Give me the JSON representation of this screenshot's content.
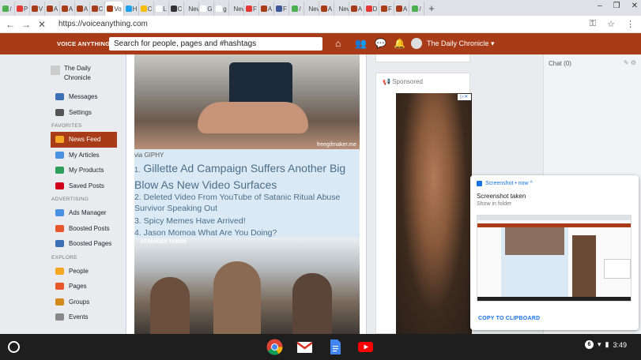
{
  "browser": {
    "tabs": [
      {
        "label": "/",
        "color": "#4caf50"
      },
      {
        "label": "P",
        "color": "#e53935"
      },
      {
        "label": "V",
        "color": "#a93c18"
      },
      {
        "label": "A",
        "color": "#a93c18"
      },
      {
        "label": "A",
        "color": "#a93c18"
      },
      {
        "label": "A",
        "color": "#a93c18"
      },
      {
        "label": "C",
        "color": "#a93c18"
      },
      {
        "label": "Vo",
        "color": "#a93c18",
        "active": true
      },
      {
        "label": "H",
        "color": "#1da1f2"
      },
      {
        "label": "C",
        "color": "#fbbc04"
      },
      {
        "label": "L",
        "color": "#fff"
      },
      {
        "label": "C",
        "color": "#333"
      },
      {
        "label": "New",
        "color": "#dee1e6"
      },
      {
        "label": "G",
        "color": "#fff"
      },
      {
        "label": "g",
        "color": "#fff"
      },
      {
        "label": "New",
        "color": "#dee1e6"
      },
      {
        "label": "F",
        "color": "#e53935"
      },
      {
        "label": "A",
        "color": "#a93c18"
      },
      {
        "label": "F",
        "color": "#3b5998"
      },
      {
        "label": "/",
        "color": "#4caf50"
      },
      {
        "label": "New",
        "color": "#dee1e6"
      },
      {
        "label": "A",
        "color": "#a93c18"
      },
      {
        "label": "New",
        "color": "#dee1e6"
      },
      {
        "label": "A",
        "color": "#a93c18"
      },
      {
        "label": "D",
        "color": "#e53935"
      },
      {
        "label": "F",
        "color": "#a93c18"
      },
      {
        "label": "A",
        "color": "#a93c18"
      },
      {
        "label": "/",
        "color": "#4caf50"
      }
    ],
    "new_tab": "+",
    "url": "https://voiceanything.com"
  },
  "header": {
    "brand": "VOICE ANYTHING",
    "search_placeholder": "Search for people, pages and #hashtags",
    "user_name": "The Daily Chronicle ▾"
  },
  "sidebar": {
    "profile_name": "The Daily Chronicle",
    "top_items": [
      {
        "label": "Messages",
        "color": "#3b6fb6"
      },
      {
        "label": "Settings",
        "color": "#555"
      }
    ],
    "favorites_label": "FAVORITES",
    "favorites": [
      {
        "label": "News Feed",
        "color": "#f5a623",
        "active": true
      },
      {
        "label": "My Articles",
        "color": "#4a90e2"
      },
      {
        "label": "My Products",
        "color": "#2e9e5b"
      },
      {
        "label": "Saved Posts",
        "color": "#d0021b"
      }
    ],
    "advertising_label": "ADVERTISING",
    "advertising": [
      {
        "label": "Ads Manager",
        "color": "#4a90e2"
      },
      {
        "label": "Boosted Posts",
        "color": "#e8562b"
      },
      {
        "label": "Boosted Pages",
        "color": "#3b6fb6"
      }
    ],
    "explore_label": "EXPLORE",
    "explore": [
      {
        "label": "People",
        "color": "#f5a623"
      },
      {
        "label": "Pages",
        "color": "#e8562b"
      },
      {
        "label": "Groups",
        "color": "#d48a1a"
      },
      {
        "label": "Events",
        "color": "#888"
      }
    ]
  },
  "feed": {
    "image1_watermark": "freegifmaker.me",
    "via": "via GIPHY",
    "headline_number": "1.",
    "headline": "Gillette Ad Campaign Suffers Another Big Blow As New Video Surfaces",
    "items": [
      "2. Deleted Video From YouTube of Satanic Ritual Abuse Survivor Speaking Out",
      "3. Spicy Memes Have Arrived!",
      "4. Jason Momoa What Are You Doing?"
    ],
    "image2_watermark": "STRANGER THINGS"
  },
  "ads": {
    "sponsored_label": "Sponsored",
    "ad_choices": "▷✕"
  },
  "chat": {
    "title": "Chat (0)",
    "icons": "✎ ⚙"
  },
  "notification": {
    "app": "Screenshot • now ^",
    "title": "Screenshot taken",
    "subtitle": "Show in folder",
    "action": "COPY TO CLIPBOARD"
  },
  "shelf": {
    "badge": "6",
    "time": "3:49"
  }
}
